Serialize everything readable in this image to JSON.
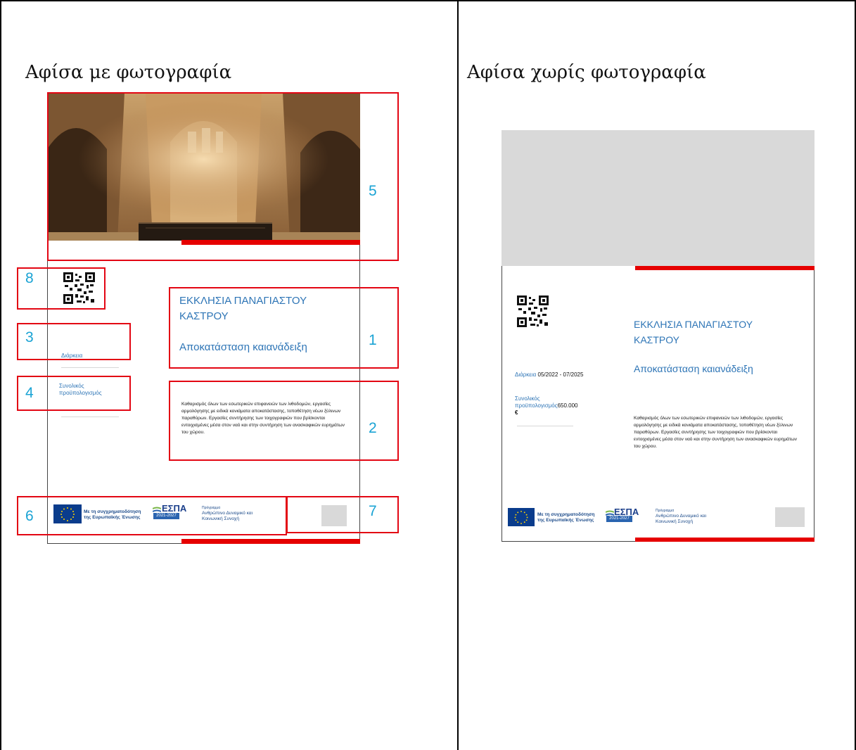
{
  "columns": [
    {
      "title": "Αφίσα με φωτογραφία"
    },
    {
      "title": "Αφίσα χωρίς φωτογραφία"
    }
  ],
  "poster": {
    "title_line1": "ΕΚΚΛΗΣΙΑ ΠΑΝΑΓΙΑΣΤΟΥ",
    "title_line2": "ΚΑΣΤΡΟΥ",
    "subtitle": "Αποκατάσταση καιανάδειξη",
    "duration_label": "Διάρκεια",
    "duration_value": "05/2022 - 07/2025",
    "budget_label_line1": "Συνολικός",
    "budget_label_line2": "προϋπολογισμός",
    "budget_value": "650.000",
    "budget_currency": "€",
    "description": "Καθαρισμός όλων των εσωτερικών επιφανειών των λιθοδομών, εργασίες αρμολόγησης με ειδικά κονιάματα αποκατάστασης, τοποθέτηση νέων ξύλινων παραθύρων. Εργασίες συντήρησης των τοιχογραφιών που βρίσκονται εντοιχισμένες μέσα στον ναό και στην συντήρηση των ανασκαφικών ευρημάτων του χώρου.",
    "cofund_line1": "Με τη συγχρηματοδότηση",
    "cofund_line2": "της Ευρωπαϊκής Ένωσης",
    "espa_name": "ΕΣΠΑ",
    "espa_years": "2021-2027",
    "program_label": "Πρόγραμμα",
    "program_line1": "Ανθρώπινο Δυναμικό και",
    "program_line2": "Κοινωνική Συνοχή"
  },
  "callouts": [
    "1",
    "2",
    "3",
    "4",
    "5",
    "6",
    "7",
    "8"
  ],
  "colors": {
    "accent_red": "#e60000",
    "callout_blue": "#1aa3d4",
    "title_blue": "#2e75b6",
    "placeholder_gray": "#d9d9d9"
  }
}
